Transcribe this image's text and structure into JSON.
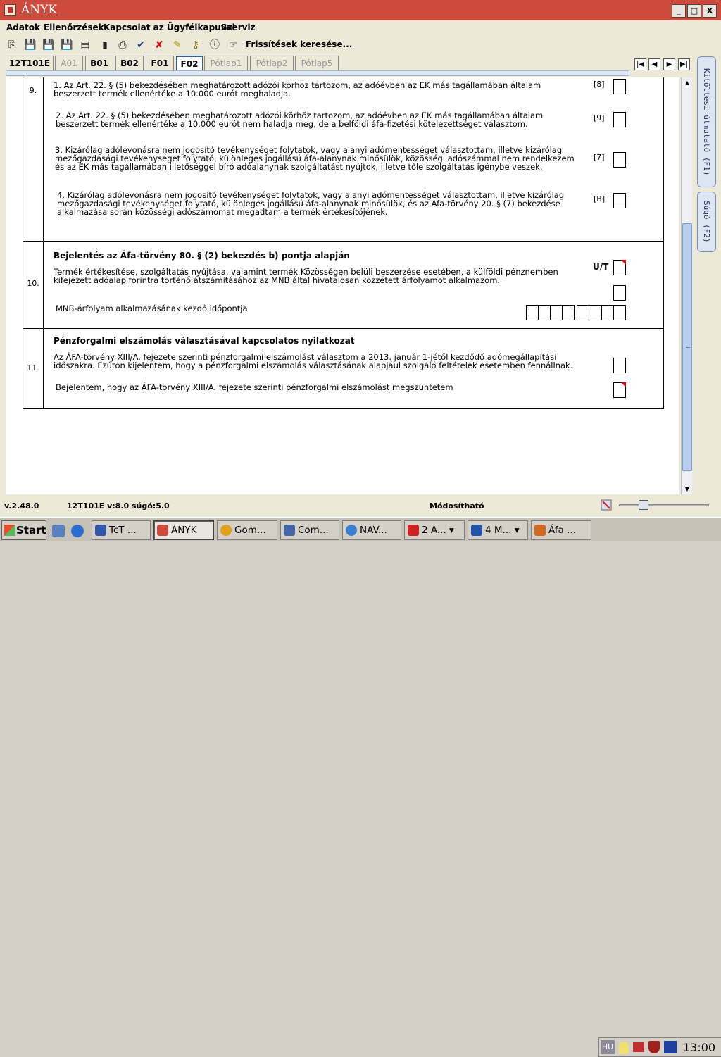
{
  "window": {
    "title": "ÁNYK",
    "controls": {
      "minimize": "_",
      "maximize": "□",
      "close": "X"
    }
  },
  "menu": {
    "items": [
      "Adatok",
      "Ellenőrzések",
      "Kapcsolat az Ügyfélkapuval",
      "Szerviz"
    ]
  },
  "toolbar": {
    "update_label": "Frissítések keresése...",
    "icons": [
      "copy-icon",
      "save-icon",
      "delete-save-icon",
      "save-as-icon",
      "print-preview-icon",
      "info-doc-icon",
      "print-icon",
      "check-icon",
      "cancel-icon",
      "edit-icon",
      "key-icon",
      "info-icon",
      "pointer-icon"
    ]
  },
  "tabs": [
    {
      "label": "12T101E",
      "state": "normal"
    },
    {
      "label": "A01",
      "state": "dim"
    },
    {
      "label": "B01",
      "state": "normal"
    },
    {
      "label": "B02",
      "state": "normal"
    },
    {
      "label": "F01",
      "state": "normal"
    },
    {
      "label": "F02",
      "state": "active"
    },
    {
      "label": "Pótlap1",
      "state": "dim"
    },
    {
      "label": "Pótlap2",
      "state": "dim"
    },
    {
      "label": "Pótlap5",
      "state": "dim"
    }
  ],
  "side_panel": {
    "tab1": "Kitöltési útmutató (F1)",
    "tab2": "Súgó (F2)"
  },
  "form": {
    "row9": {
      "number": "9.",
      "items": [
        {
          "code": "[8]",
          "text": "1. Az Art. 22. § (5) bekezdésében meghatározott adózói körhöz tartozom, az adóévben az EK más tagállamában általam beszerzett termék ellenértéke a 10.000 eurót meghaladja."
        },
        {
          "code": "[9]",
          "text": "2. Az Art. 22. § (5) bekezdésében meghatározott adózói körhöz tartozom, az adóévben az EK más tagállamában általam beszerzett termék ellenértéke a 10.000 eurót nem haladja meg, de a belföldi áfa-fizetési kötelezettséget választom."
        },
        {
          "code": "[7]",
          "text": "3. Kizárólag adólevonásra nem jogosító tevékenységet folytatok, vagy alanyi adómentességet választottam, illetve kizárólag mezőgazdasági tevékenységet folytató, különleges jogállású áfa-alanynak minősülök, közösségi adószámmal nem rendelkezem és az EK más tagállamában illetőséggel bíró adóalanynak szolgáltatást nyújtok, illetve tőle szolgáltatás igénybe veszek."
        },
        {
          "code": "[B]",
          "text": "4. Kizárólag adólevonásra nem jogosító tevékenységet folytatok, vagy alanyi adómentességet választottam, illetve kizárólag mezőgazdasági tevékenységet folytató, különleges jogállású áfa-alanynak minősülök, és az Áfa-törvény 20. § (7) bekezdése alkalmazása során közösségi adószámomat megadtam a termék értékesítőjének."
        }
      ]
    },
    "row10": {
      "number": "10.",
      "heading": "Bejelentés az Áfa-törvény 80. § (2) bekezdés b) pontja alapján",
      "ut_label": "U/T",
      "text": "Termék értékesítése, szolgáltatás nyújtása, valamint termék Közösségen belüli beszerzése esetében, a külföldi pénznemben kifejezett adóalap forintra történő átszámításához az MNB által hivatalosan közzétett árfolyamot alkalmazom.",
      "date_label": "MNB-árfolyam alkalmazásának kezdő időpontja"
    },
    "row11": {
      "number": "11.",
      "heading": "Pénzforgalmi elszámolás választásával kapcsolatos nyilatkozat",
      "text1": "Az ÁFA-törvény XIII/A. fejezete szerinti pénzforgalmi elszámolást választom a 2013. január 1-jétől kezdődő adómegállapítási időszakra. Ezúton kijelentem, hogy a pénzforgalmi elszámolás választásának alapjául szolgáló feltételek esetemben fennállnak.",
      "text2": "Bejelentem, hogy az ÁFA-törvény XIII/A. fejezete szerinti pénzforgalmi elszámolást megszüntetem"
    }
  },
  "status": {
    "version": "v.2.48.0",
    "form_info": "12T101E v:8.0 súgó:5.0",
    "mode": "Módosítható"
  },
  "taskbar": {
    "start": "Start",
    "items": [
      {
        "label": "TcT ...",
        "color": "#3355aa"
      },
      {
        "label": "ÁNYK",
        "color": "#cc4b3c",
        "active": true
      },
      {
        "label": "Gom...",
        "color": "#e0a020"
      },
      {
        "label": "Com...",
        "color": "#4466aa"
      },
      {
        "label": "NAV...",
        "color": "#3a7fd0"
      },
      {
        "label": "2 A...",
        "color": "#cc2222"
      },
      {
        "label": "4 M...",
        "color": "#2255aa"
      },
      {
        "label": "Áfa ...",
        "color": "#d06a20"
      }
    ],
    "tray_lang": "HU",
    "clock": "13:00"
  }
}
